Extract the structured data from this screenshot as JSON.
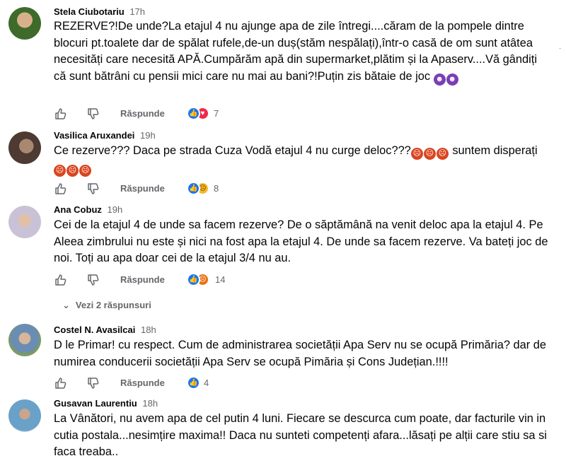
{
  "comments": [
    {
      "author": "Stela Ciubotariu",
      "time": "17h",
      "text": "REZERVE?!De unde?La etajul 4 nu ajunge apa de zile întregi....căram de la pompele dintre blocuri pt.toalete dar de spălat rufele,de-un duș(stăm nespălați),într-o casă de om sunt atâtea necesități care necesită APĂ.Cumpărăm apă din supermarket,plătim și la Apaserv....Vă gândiți că sunt bătrâni cu pensii mici care nu mai au bani?!Puțin zis bătaie de joc",
      "emojis": [
        "devil",
        "devil"
      ],
      "reply_label": "Răspunde",
      "reactions": [
        "like",
        "love"
      ],
      "reaction_count": "7"
    },
    {
      "author": "Vasilica Aruxandei",
      "time": "19h",
      "text": "Ce rezerve??? Daca pe strada Cuza Vodă etajul 4 nu curge deloc???",
      "text_mid": " suntem disperați ",
      "emojis_mid": [
        "angry",
        "angry",
        "angry"
      ],
      "emojis_end": [
        "angry",
        "angry",
        "angry"
      ],
      "reply_label": "Răspunde",
      "reactions": [
        "like",
        "sad"
      ],
      "reaction_count": "8"
    },
    {
      "author": "Ana Cobuz",
      "time": "19h",
      "text": "Cei de la etajul 4 de unde sa facem rezerve? De o săptămână na venit deloc apa la etajul 4. Pe Aleea zimbrului nu este și nici na fost apa la etajul 4. De unde sa facem rezerve. Va bateți joc de noi. Toți au apa doar cei de la etajul 3/4 nu au.",
      "reply_label": "Răspunde",
      "reactions": [
        "like",
        "angry"
      ],
      "reaction_count": "14",
      "view_replies": "Vezi 2 răspunsuri"
    },
    {
      "author": "Costel N. Avasilcai",
      "time": "18h",
      "text": "D le Primar! cu respect. Cum de administrarea societății Apa Serv nu se ocupă Primăria? dar de numirea conducerii societății Apa Serv se ocupă Pimăria și Cons Județian.!!!!",
      "reply_label": "Răspunde",
      "reactions": [
        "like"
      ],
      "reaction_count": "4"
    },
    {
      "author": "Gusavan Laurentiu",
      "time": "18h",
      "text": "La Vânători, nu avem apa de cel putin 4 luni. Fiecare se descurca cum poate, dar facturile vin in cutia postala...nesimțire maxima!! Daca nu sunteti competenți afara...lăsați pe alții care stiu sa si faca treaba.."
    }
  ],
  "more_options_icon": "more-vertical-icon",
  "colors": {
    "text": "#050505",
    "secondary": "#65676b",
    "like": "#1877f2",
    "love": "#f0284a",
    "sad": "#f7b928",
    "angry": "#e9710f"
  }
}
